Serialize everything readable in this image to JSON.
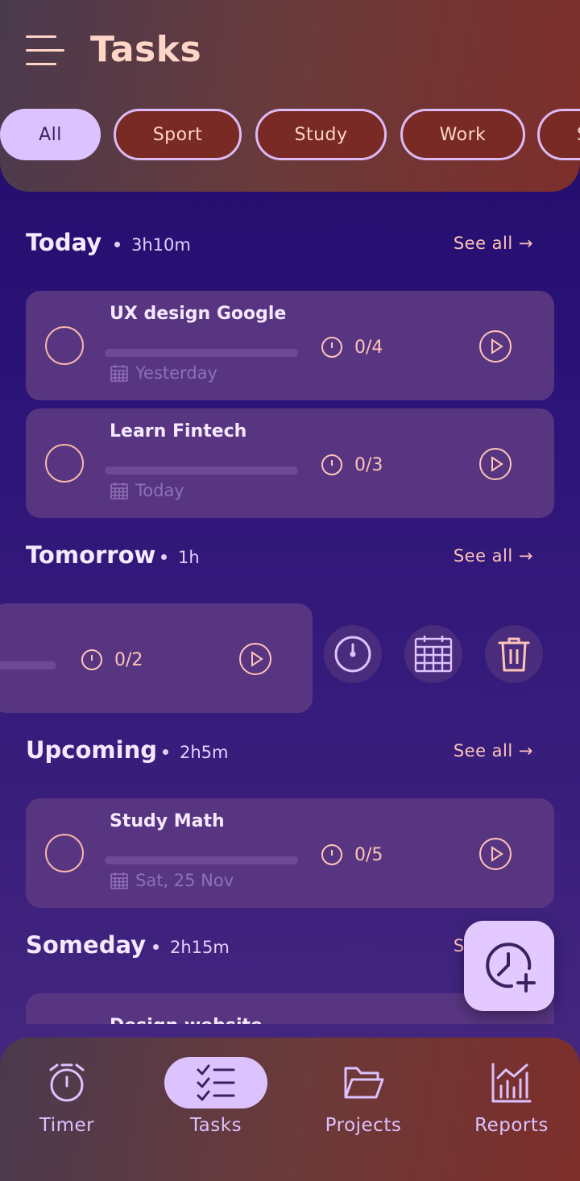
{
  "header": {
    "title": "Tasks",
    "filters": [
      {
        "label": "All",
        "active": true
      },
      {
        "label": "Sport",
        "active": false
      },
      {
        "label": "Study",
        "active": false
      },
      {
        "label": "Work",
        "active": false
      },
      {
        "label": "S",
        "active": false
      }
    ]
  },
  "sections": {
    "today": {
      "title": "Today",
      "duration": "3h10m",
      "see_all": "See all",
      "tasks": [
        {
          "title": "UX design Google",
          "pomodoros": "0/4",
          "due": "Yesterday"
        },
        {
          "title": "Learn Fintech",
          "pomodoros": "0/3",
          "due": "Today"
        }
      ]
    },
    "tomorrow": {
      "title": "Tomorrow",
      "duration": "1h",
      "see_all": "See all",
      "tasks": [
        {
          "pomodoros": "0/2"
        }
      ]
    },
    "upcoming": {
      "title": "Upcoming",
      "duration": "2h5m",
      "see_all": "See all",
      "tasks": [
        {
          "title": "Study Math",
          "pomodoros": "0/5",
          "due": "Sat, 25 Nov"
        }
      ]
    },
    "someday": {
      "title": "Someday",
      "duration": "2h15m",
      "see_all": "See all",
      "tasks": [
        {
          "title": "Design website"
        }
      ]
    }
  },
  "nav": {
    "items": [
      {
        "label": "Timer",
        "icon": "alarm-clock-icon",
        "active": false
      },
      {
        "label": "Tasks",
        "icon": "checklist-icon",
        "active": true
      },
      {
        "label": "Projects",
        "icon": "folder-icon",
        "active": false
      },
      {
        "label": "Reports",
        "icon": "chart-icon",
        "active": false
      }
    ]
  },
  "colors": {
    "accent": "#dcc2ff",
    "header_bg": "#7d2e2a",
    "card_bg": "#583581",
    "salmon": "#ffc4b8"
  }
}
